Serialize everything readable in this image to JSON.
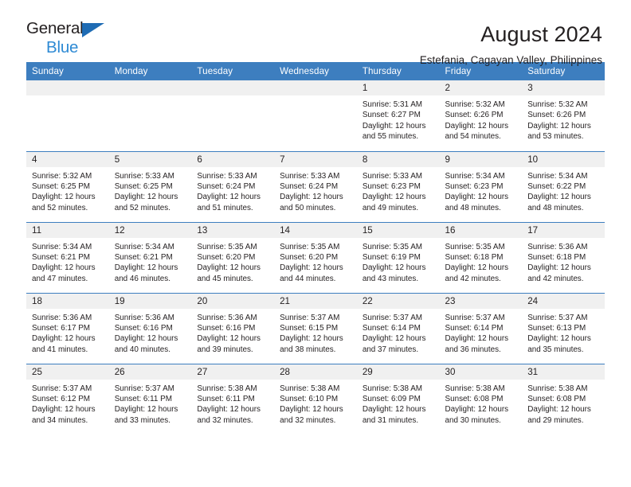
{
  "brand": {
    "name_line1": "General",
    "name_line2": "Blue",
    "accent_color": "#2e8ad4",
    "header_color": "#3d7ebf"
  },
  "header": {
    "title": "August 2024",
    "subtitle": "Estefania, Cagayan Valley, Philippines"
  },
  "weekday_headers": [
    "Sunday",
    "Monday",
    "Tuesday",
    "Wednesday",
    "Thursday",
    "Friday",
    "Saturday"
  ],
  "weeks": [
    [
      {
        "day": "",
        "sunrise": "",
        "sunset": "",
        "daylight": ""
      },
      {
        "day": "",
        "sunrise": "",
        "sunset": "",
        "daylight": ""
      },
      {
        "day": "",
        "sunrise": "",
        "sunset": "",
        "daylight": ""
      },
      {
        "day": "",
        "sunrise": "",
        "sunset": "",
        "daylight": ""
      },
      {
        "day": "1",
        "sunrise": "Sunrise: 5:31 AM",
        "sunset": "Sunset: 6:27 PM",
        "daylight": "Daylight: 12 hours and 55 minutes."
      },
      {
        "day": "2",
        "sunrise": "Sunrise: 5:32 AM",
        "sunset": "Sunset: 6:26 PM",
        "daylight": "Daylight: 12 hours and 54 minutes."
      },
      {
        "day": "3",
        "sunrise": "Sunrise: 5:32 AM",
        "sunset": "Sunset: 6:26 PM",
        "daylight": "Daylight: 12 hours and 53 minutes."
      }
    ],
    [
      {
        "day": "4",
        "sunrise": "Sunrise: 5:32 AM",
        "sunset": "Sunset: 6:25 PM",
        "daylight": "Daylight: 12 hours and 52 minutes."
      },
      {
        "day": "5",
        "sunrise": "Sunrise: 5:33 AM",
        "sunset": "Sunset: 6:25 PM",
        "daylight": "Daylight: 12 hours and 52 minutes."
      },
      {
        "day": "6",
        "sunrise": "Sunrise: 5:33 AM",
        "sunset": "Sunset: 6:24 PM",
        "daylight": "Daylight: 12 hours and 51 minutes."
      },
      {
        "day": "7",
        "sunrise": "Sunrise: 5:33 AM",
        "sunset": "Sunset: 6:24 PM",
        "daylight": "Daylight: 12 hours and 50 minutes."
      },
      {
        "day": "8",
        "sunrise": "Sunrise: 5:33 AM",
        "sunset": "Sunset: 6:23 PM",
        "daylight": "Daylight: 12 hours and 49 minutes."
      },
      {
        "day": "9",
        "sunrise": "Sunrise: 5:34 AM",
        "sunset": "Sunset: 6:23 PM",
        "daylight": "Daylight: 12 hours and 48 minutes."
      },
      {
        "day": "10",
        "sunrise": "Sunrise: 5:34 AM",
        "sunset": "Sunset: 6:22 PM",
        "daylight": "Daylight: 12 hours and 48 minutes."
      }
    ],
    [
      {
        "day": "11",
        "sunrise": "Sunrise: 5:34 AM",
        "sunset": "Sunset: 6:21 PM",
        "daylight": "Daylight: 12 hours and 47 minutes."
      },
      {
        "day": "12",
        "sunrise": "Sunrise: 5:34 AM",
        "sunset": "Sunset: 6:21 PM",
        "daylight": "Daylight: 12 hours and 46 minutes."
      },
      {
        "day": "13",
        "sunrise": "Sunrise: 5:35 AM",
        "sunset": "Sunset: 6:20 PM",
        "daylight": "Daylight: 12 hours and 45 minutes."
      },
      {
        "day": "14",
        "sunrise": "Sunrise: 5:35 AM",
        "sunset": "Sunset: 6:20 PM",
        "daylight": "Daylight: 12 hours and 44 minutes."
      },
      {
        "day": "15",
        "sunrise": "Sunrise: 5:35 AM",
        "sunset": "Sunset: 6:19 PM",
        "daylight": "Daylight: 12 hours and 43 minutes."
      },
      {
        "day": "16",
        "sunrise": "Sunrise: 5:35 AM",
        "sunset": "Sunset: 6:18 PM",
        "daylight": "Daylight: 12 hours and 42 minutes."
      },
      {
        "day": "17",
        "sunrise": "Sunrise: 5:36 AM",
        "sunset": "Sunset: 6:18 PM",
        "daylight": "Daylight: 12 hours and 42 minutes."
      }
    ],
    [
      {
        "day": "18",
        "sunrise": "Sunrise: 5:36 AM",
        "sunset": "Sunset: 6:17 PM",
        "daylight": "Daylight: 12 hours and 41 minutes."
      },
      {
        "day": "19",
        "sunrise": "Sunrise: 5:36 AM",
        "sunset": "Sunset: 6:16 PM",
        "daylight": "Daylight: 12 hours and 40 minutes."
      },
      {
        "day": "20",
        "sunrise": "Sunrise: 5:36 AM",
        "sunset": "Sunset: 6:16 PM",
        "daylight": "Daylight: 12 hours and 39 minutes."
      },
      {
        "day": "21",
        "sunrise": "Sunrise: 5:37 AM",
        "sunset": "Sunset: 6:15 PM",
        "daylight": "Daylight: 12 hours and 38 minutes."
      },
      {
        "day": "22",
        "sunrise": "Sunrise: 5:37 AM",
        "sunset": "Sunset: 6:14 PM",
        "daylight": "Daylight: 12 hours and 37 minutes."
      },
      {
        "day": "23",
        "sunrise": "Sunrise: 5:37 AM",
        "sunset": "Sunset: 6:14 PM",
        "daylight": "Daylight: 12 hours and 36 minutes."
      },
      {
        "day": "24",
        "sunrise": "Sunrise: 5:37 AM",
        "sunset": "Sunset: 6:13 PM",
        "daylight": "Daylight: 12 hours and 35 minutes."
      }
    ],
    [
      {
        "day": "25",
        "sunrise": "Sunrise: 5:37 AM",
        "sunset": "Sunset: 6:12 PM",
        "daylight": "Daylight: 12 hours and 34 minutes."
      },
      {
        "day": "26",
        "sunrise": "Sunrise: 5:37 AM",
        "sunset": "Sunset: 6:11 PM",
        "daylight": "Daylight: 12 hours and 33 minutes."
      },
      {
        "day": "27",
        "sunrise": "Sunrise: 5:38 AM",
        "sunset": "Sunset: 6:11 PM",
        "daylight": "Daylight: 12 hours and 32 minutes."
      },
      {
        "day": "28",
        "sunrise": "Sunrise: 5:38 AM",
        "sunset": "Sunset: 6:10 PM",
        "daylight": "Daylight: 12 hours and 32 minutes."
      },
      {
        "day": "29",
        "sunrise": "Sunrise: 5:38 AM",
        "sunset": "Sunset: 6:09 PM",
        "daylight": "Daylight: 12 hours and 31 minutes."
      },
      {
        "day": "30",
        "sunrise": "Sunrise: 5:38 AM",
        "sunset": "Sunset: 6:08 PM",
        "daylight": "Daylight: 12 hours and 30 minutes."
      },
      {
        "day": "31",
        "sunrise": "Sunrise: 5:38 AM",
        "sunset": "Sunset: 6:08 PM",
        "daylight": "Daylight: 12 hours and 29 minutes."
      }
    ]
  ]
}
